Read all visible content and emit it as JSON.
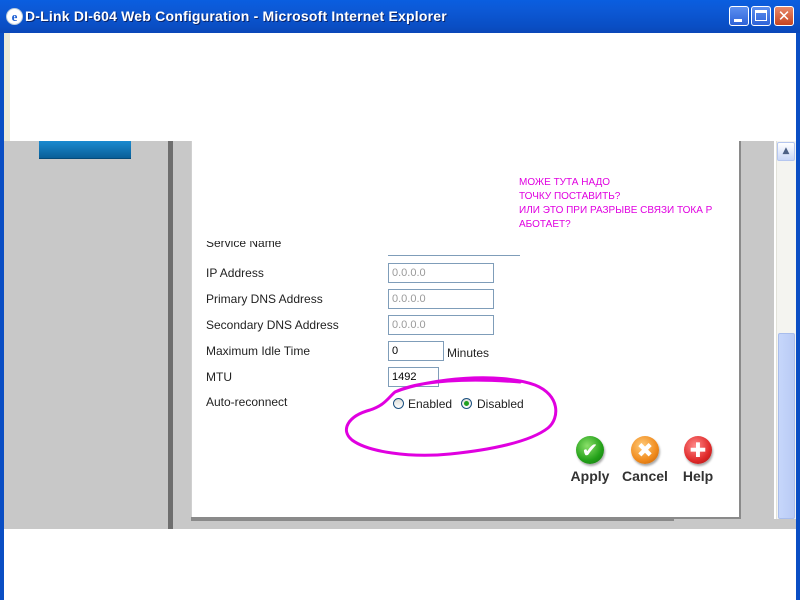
{
  "window": {
    "title": "D-Link DI-604 Web Configuration - Microsoft Internet Explorer",
    "app_icon": "e",
    "controls": {
      "minimize": "",
      "maximize": "",
      "close": "✕"
    }
  },
  "sidebar": {
    "button_label": ""
  },
  "form": {
    "fields": [
      {
        "label": "IP Address",
        "value": "0.0.0.0",
        "placeholder_style": true
      },
      {
        "label": "Primary DNS Address",
        "value": "0.0.0.0",
        "placeholder_style": true
      },
      {
        "label": "Secondary DNS Address",
        "value": "0.0.0.0",
        "placeholder_style": true
      },
      {
        "label": "Maximum Idle Time",
        "value": "0",
        "unit": "Minutes"
      },
      {
        "label": "MTU",
        "value": "1492"
      }
    ],
    "auto_reconnect": {
      "label": "Auto-reconnect",
      "options": [
        {
          "label": "Enabled",
          "selected": false
        },
        {
          "label": "Disabled",
          "selected": true
        }
      ]
    }
  },
  "annotation": {
    "color": "#e000e0",
    "lines": [
      "МОЖЕ ТУТА НАДО",
      "ТОЧКУ ПОСТАВИТЬ?",
      "ИЛИ ЭТО ПРИ РАЗРЫВЕ СВЯЗИ ТОКА Р",
      "АБОТАЕТ?"
    ]
  },
  "actions": {
    "apply": "Apply",
    "cancel": "Cancel",
    "help": "Help"
  },
  "icons": {
    "apply": "check-icon",
    "cancel": "x-icon",
    "help": "plus-icon"
  }
}
